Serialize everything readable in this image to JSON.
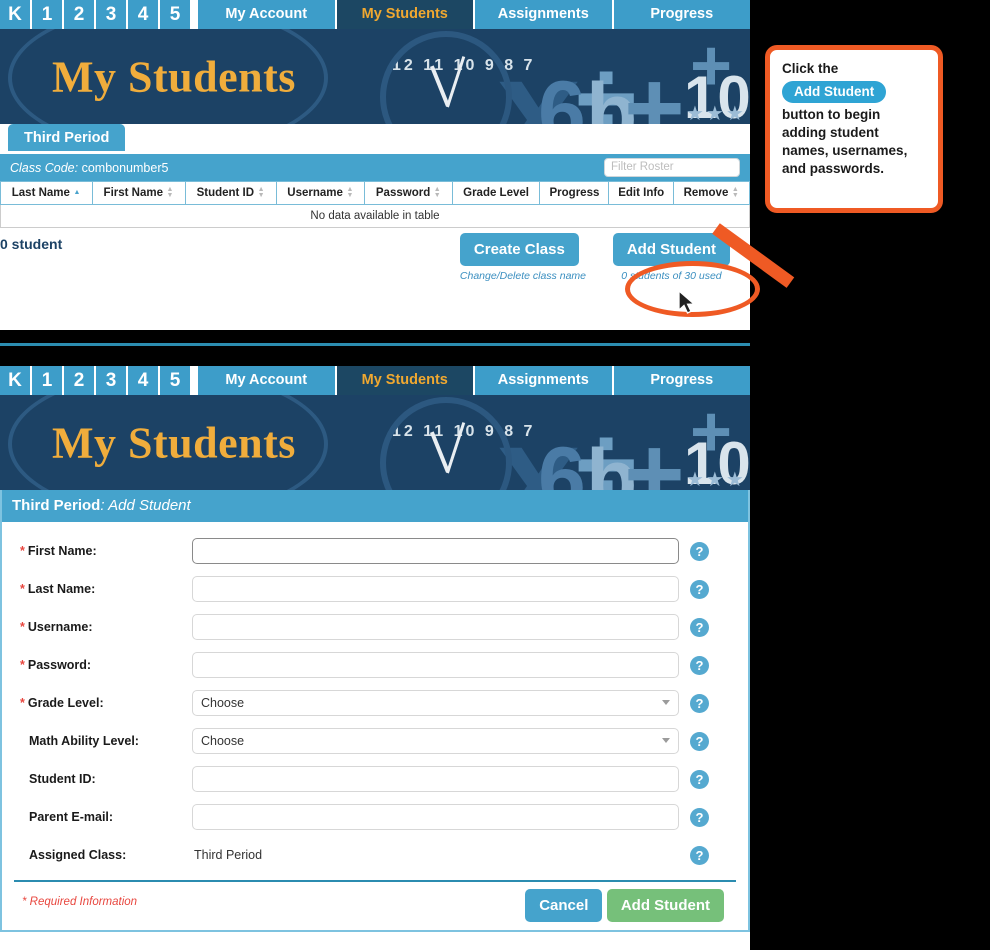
{
  "nav": {
    "grade_buttons": [
      "K",
      "1",
      "2",
      "3",
      "4",
      "5"
    ],
    "tabs": [
      {
        "label": "My Account",
        "active": false
      },
      {
        "label": "My Students",
        "active": true
      },
      {
        "label": "Assignments",
        "active": false
      },
      {
        "label": "Progress",
        "active": false
      }
    ]
  },
  "banner": {
    "title": "My Students",
    "clock_numbers": "12 11 10 9 8 7",
    "symbols": [
      "x",
      "÷",
      "6",
      "b",
      "+",
      "10",
      "+",
      "★★★"
    ]
  },
  "roster": {
    "class_tab": "Third Period",
    "class_code_label": "Class Code:",
    "class_code_value": "combonumber5",
    "filter_placeholder": "Filter Roster",
    "columns": [
      {
        "label": "Last Name",
        "sort": "asc"
      },
      {
        "label": "First Name",
        "sort": "none"
      },
      {
        "label": "Student ID",
        "sort": "none"
      },
      {
        "label": "Username",
        "sort": "none"
      },
      {
        "label": "Password",
        "sort": "none"
      },
      {
        "label": "Grade Level",
        "sort": null
      },
      {
        "label": "Progress",
        "sort": null
      },
      {
        "label": "Edit Info",
        "sort": null
      },
      {
        "label": "Remove",
        "sort": "none"
      }
    ],
    "empty_message": "No data available in table",
    "count_label": "0 student",
    "create_class_label": "Create Class",
    "add_student_label": "Add Student",
    "change_delete_link": "Change/Delete class name",
    "seats_used_link": "0 students of 30 used"
  },
  "callout": {
    "line1": "Click the",
    "chip": "Add Student",
    "line2": "button to begin adding student names, usernames, and passwords.",
    "accent_color": "#ef5a24"
  },
  "form": {
    "header_class": "Third Period",
    "header_action": ": Add Student",
    "fields": [
      {
        "label": "First Name:",
        "required": true,
        "type": "text",
        "value": "",
        "focused": true
      },
      {
        "label": "Last Name:",
        "required": true,
        "type": "text",
        "value": "",
        "focused": false
      },
      {
        "label": "Username:",
        "required": true,
        "type": "text",
        "value": "",
        "focused": false
      },
      {
        "label": "Password:",
        "required": true,
        "type": "text",
        "value": "",
        "focused": false
      },
      {
        "label": "Grade Level:",
        "required": true,
        "type": "select",
        "value": "Choose",
        "focused": false
      },
      {
        "label": "Math Ability Level:",
        "required": false,
        "type": "select",
        "value": "Choose",
        "focused": false
      },
      {
        "label": "Student ID:",
        "required": false,
        "type": "text",
        "value": "",
        "focused": false
      },
      {
        "label": "Parent E-mail:",
        "required": false,
        "type": "text",
        "value": "",
        "focused": false
      },
      {
        "label": "Assigned Class:",
        "required": false,
        "type": "static",
        "value": "Third Period",
        "focused": false
      }
    ],
    "help_icon": "?",
    "required_note": "* Required Information",
    "cancel_label": "Cancel",
    "submit_label": "Add Student"
  },
  "colors": {
    "primary_blue": "#45a3cc",
    "dark_navy": "#1c4265",
    "gold": "#f0ad3c",
    "orange": "#ef5a24",
    "green": "#76c07a",
    "required_red": "#e8473f"
  }
}
